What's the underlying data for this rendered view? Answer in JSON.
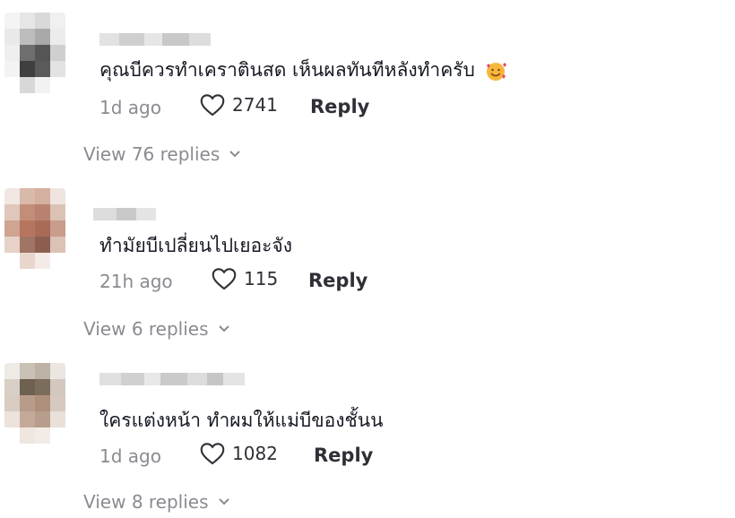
{
  "comments": [
    {
      "text": "คุณบีควรทำเคราตินสด เห็นผลทันทีหลังทำครับ",
      "emoji": "smiling-face-with-hearts-icon",
      "time": "1d ago",
      "likes": "2741",
      "reply_label": "Reply",
      "view_replies": "View 76 replies"
    },
    {
      "text": "ทำมัยบีเปลี่ยนไปเยอะจัง",
      "time": "21h ago",
      "likes": "115",
      "reply_label": "Reply",
      "view_replies": "View 6 replies"
    },
    {
      "text": "ใครแต่งหน้า ทำผมให้แม่บีของชั้นน",
      "time": "1d ago",
      "likes": "1082",
      "reply_label": "Reply",
      "view_replies": "View 8 replies"
    }
  ],
  "colors": {
    "text_primary": "#161823",
    "text_secondary": "#8a8b91",
    "action": "#2f3037"
  }
}
